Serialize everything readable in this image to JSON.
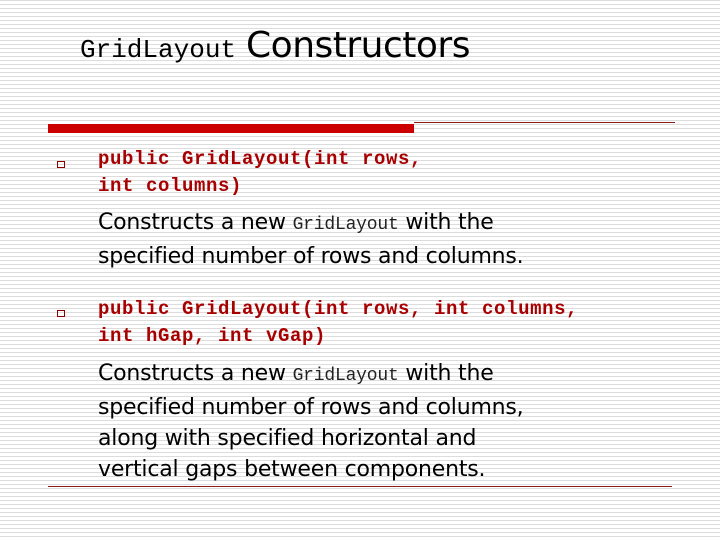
{
  "title": {
    "code_part": "GridLayout",
    "text_part": "Constructors"
  },
  "colors": {
    "accent_bar": "#cc0000",
    "rule_line": "#8b1a1a",
    "code_text": "#a80000",
    "bullet": "#8b0000",
    "body_text": "#000000",
    "stripe": "#dcdcdc"
  },
  "items": [
    {
      "bullet_icon": "hollow-square-bullet",
      "signature_lines": [
        "public GridLayout(int rows,",
        "int columns)"
      ],
      "description": {
        "before_code": "Constructs a new ",
        "code": "GridLayout",
        "after_code": " with the",
        "rest_lines": [
          "specified number of rows and columns."
        ]
      }
    },
    {
      "bullet_icon": "hollow-square-bullet",
      "signature_lines": [
        "public GridLayout(int rows, int columns,",
        "int hGap, int vGap)"
      ],
      "description": {
        "before_code": "Constructs a new ",
        "code": "GridLayout",
        "after_code": " with the",
        "rest_lines": [
          "specified number of rows and columns,",
          "along with specified horizontal and",
          "vertical gaps between components."
        ]
      }
    }
  ]
}
